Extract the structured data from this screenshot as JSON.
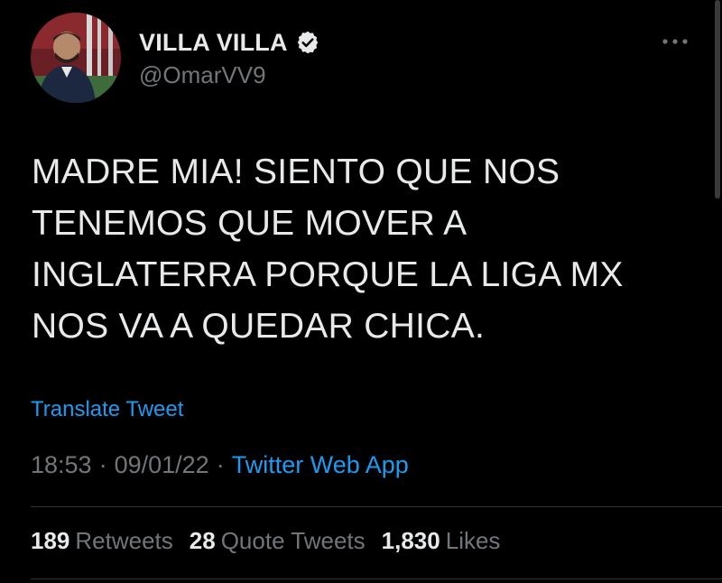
{
  "author": {
    "display_name": "VILLA VILLA",
    "handle": "@OmarVV9",
    "verified": true,
    "avatar_icon": "profile-photo"
  },
  "tweet": {
    "text": "MADRE MIA! SIENTO QUE NOS\nTENEMOS QUE MOVER A\nINGLATERRA PORQUE LA LIGA MX\nNOS VA A QUEDAR CHICA.",
    "translate_label": "Translate Tweet",
    "time": "18:53",
    "date": "09/01/22",
    "separator": "·",
    "source": "Twitter Web App"
  },
  "stats": {
    "retweets_count": "189",
    "retweets_label": "Retweets",
    "quotes_count": "28",
    "quotes_label": "Quote Tweets",
    "likes_count": "1,830",
    "likes_label": "Likes"
  },
  "colors": {
    "background": "#000000",
    "text_primary": "#e7e9ea",
    "text_secondary": "#71767b",
    "accent": "#1d9bf0",
    "divider": "#2f3336"
  },
  "icons": {
    "verified": "verified-badge-icon",
    "more": "more-options-icon"
  }
}
